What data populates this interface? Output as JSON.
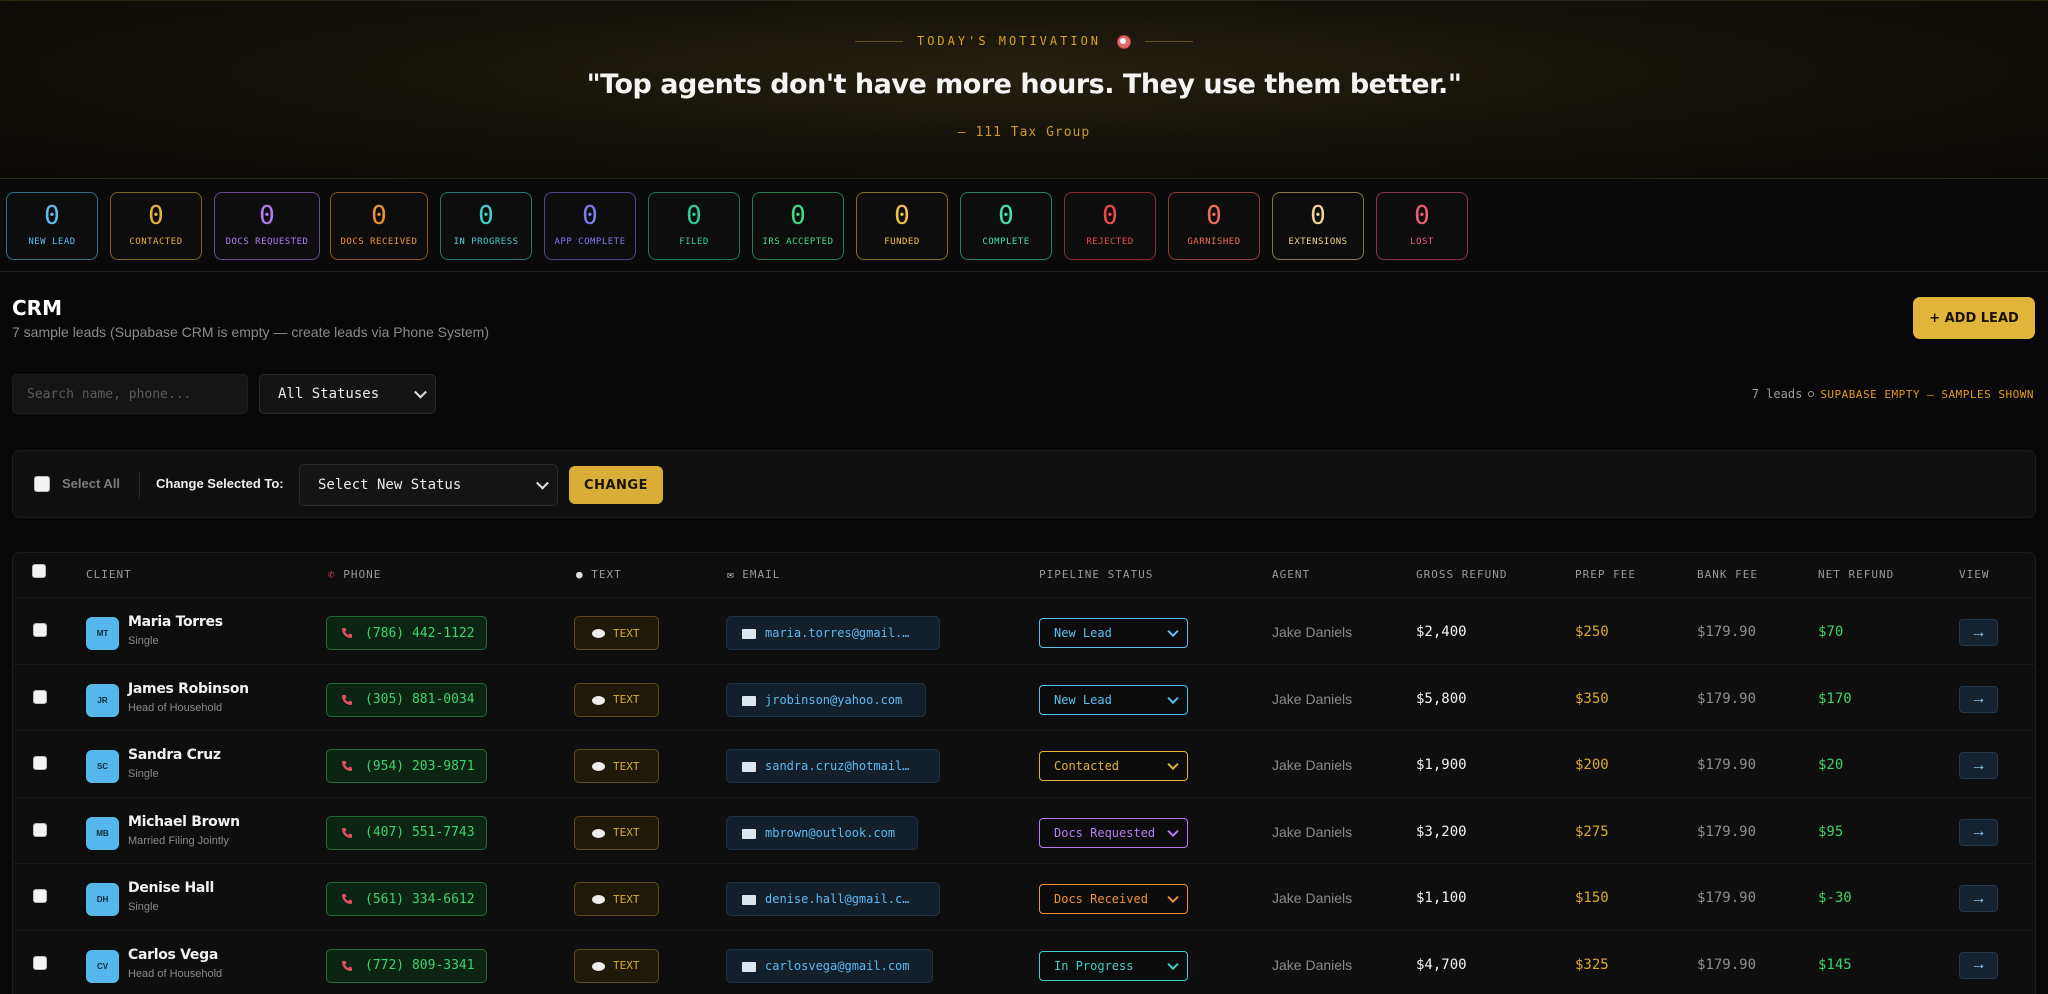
{
  "motivation": {
    "label": "TODAY'S MOTIVATION",
    "icon": "alarm-clock-icon",
    "quote": "\"Top agents don't have more hours. They use them better.\"",
    "author": "— 111 Tax Group"
  },
  "counters": [
    {
      "value": "0",
      "label": "NEW LEAD",
      "color": "#5bc0f0"
    },
    {
      "value": "0",
      "label": "CONTACTED",
      "color": "#e2b23a"
    },
    {
      "value": "0",
      "label": "DOCS REQUESTED",
      "color": "#b57cf6"
    },
    {
      "value": "0",
      "label": "DOCS RECEIVED",
      "color": "#f0923a"
    },
    {
      "value": "0",
      "label": "IN PROGRESS",
      "color": "#3fd0c8"
    },
    {
      "value": "0",
      "label": "APP COMPLETE",
      "color": "#7f7cf2"
    },
    {
      "value": "0",
      "label": "FILED",
      "color": "#2fcf95"
    },
    {
      "value": "0",
      "label": "IRS ACCEPTED",
      "color": "#3ddc84"
    },
    {
      "value": "0",
      "label": "FUNDED",
      "color": "#f1c24a"
    },
    {
      "value": "0",
      "label": "COMPLETE",
      "color": "#45e0b0"
    },
    {
      "value": "0",
      "label": "REJECTED",
      "color": "#f04a4a"
    },
    {
      "value": "0",
      "label": "GARNISHED",
      "color": "#f36b5a"
    },
    {
      "value": "0",
      "label": "EXTENSIONS",
      "color": "#f1d38a"
    },
    {
      "value": "0",
      "label": "LOST",
      "color": "#f25a78"
    }
  ],
  "crm": {
    "title": "CRM",
    "subtitle": "7 sample leads (Supabase CRM is empty — create leads via Phone System)",
    "add_label": "+ ADD LEAD"
  },
  "filters": {
    "search_placeholder": "Search name, phone...",
    "status_value": "All Statuses",
    "leads_count": "7 leads",
    "leads_note": "SUPABASE EMPTY — SAMPLES SHOWN"
  },
  "bulk": {
    "select_all": "Select All",
    "change_to": "Change Selected To:",
    "new_status_value": "Select New Status",
    "change_label": "CHANGE"
  },
  "columns": {
    "client": "CLIENT",
    "phone": "PHONE",
    "text": "TEXT",
    "email": "EMAIL",
    "pipeline": "PIPELINE STATUS",
    "agent": "AGENT",
    "gross": "GROSS REFUND",
    "prep": "PREP FEE",
    "bank": "BANK FEE",
    "net": "NET REFUND",
    "view": "VIEW"
  },
  "rows": [
    {
      "initials": "MT",
      "name": "Maria Torres",
      "filing": "Single",
      "phone": "(786) 442-1122",
      "text": "TEXT",
      "email": "maria.torres@gmail.…",
      "status": "New Lead",
      "status_color": "#5bc0f0",
      "agent": "Jake Daniels",
      "gross": "$2,400",
      "prep": "$250",
      "bank": "$179.90",
      "net": "$70",
      "view": "→"
    },
    {
      "initials": "JR",
      "name": "James Robinson",
      "filing": "Head of Household",
      "phone": "(305) 881-0034",
      "text": "TEXT",
      "email": "jrobinson@yahoo.com",
      "status": "New Lead",
      "status_color": "#5bc0f0",
      "agent": "Jake Daniels",
      "gross": "$5,800",
      "prep": "$350",
      "bank": "$179.90",
      "net": "$170",
      "view": "→"
    },
    {
      "initials": "SC",
      "name": "Sandra Cruz",
      "filing": "Single",
      "phone": "(954) 203-9871",
      "text": "TEXT",
      "email": "sandra.cruz@hotmail…",
      "status": "Contacted",
      "status_color": "#e2b23a",
      "agent": "Jake Daniels",
      "gross": "$1,900",
      "prep": "$200",
      "bank": "$179.90",
      "net": "$20",
      "view": "→"
    },
    {
      "initials": "MB",
      "name": "Michael Brown",
      "filing": "Married Filing Jointly",
      "phone": "(407) 551-7743",
      "text": "TEXT",
      "email": "mbrown@outlook.com",
      "status": "Docs Requested",
      "status_color": "#b57cf6",
      "agent": "Jake Daniels",
      "gross": "$3,200",
      "prep": "$275",
      "bank": "$179.90",
      "net": "$95",
      "view": "→"
    },
    {
      "initials": "DH",
      "name": "Denise Hall",
      "filing": "Single",
      "phone": "(561) 334-6612",
      "text": "TEXT",
      "email": "denise.hall@gmail.c…",
      "status": "Docs Received",
      "status_color": "#f0923a",
      "agent": "Jake Daniels",
      "gross": "$1,100",
      "prep": "$150",
      "bank": "$179.90",
      "net": "$-30",
      "view": "→"
    },
    {
      "initials": "CV",
      "name": "Carlos Vega",
      "filing": "Head of Household",
      "phone": "(772) 809-3341",
      "text": "TEXT",
      "email": "carlosvega@gmail.com",
      "status": "In Progress",
      "status_color": "#3fd0c8",
      "agent": "Jake Daniels",
      "gross": "$4,700",
      "prep": "$325",
      "bank": "$179.90",
      "net": "$145",
      "view": "→"
    }
  ]
}
